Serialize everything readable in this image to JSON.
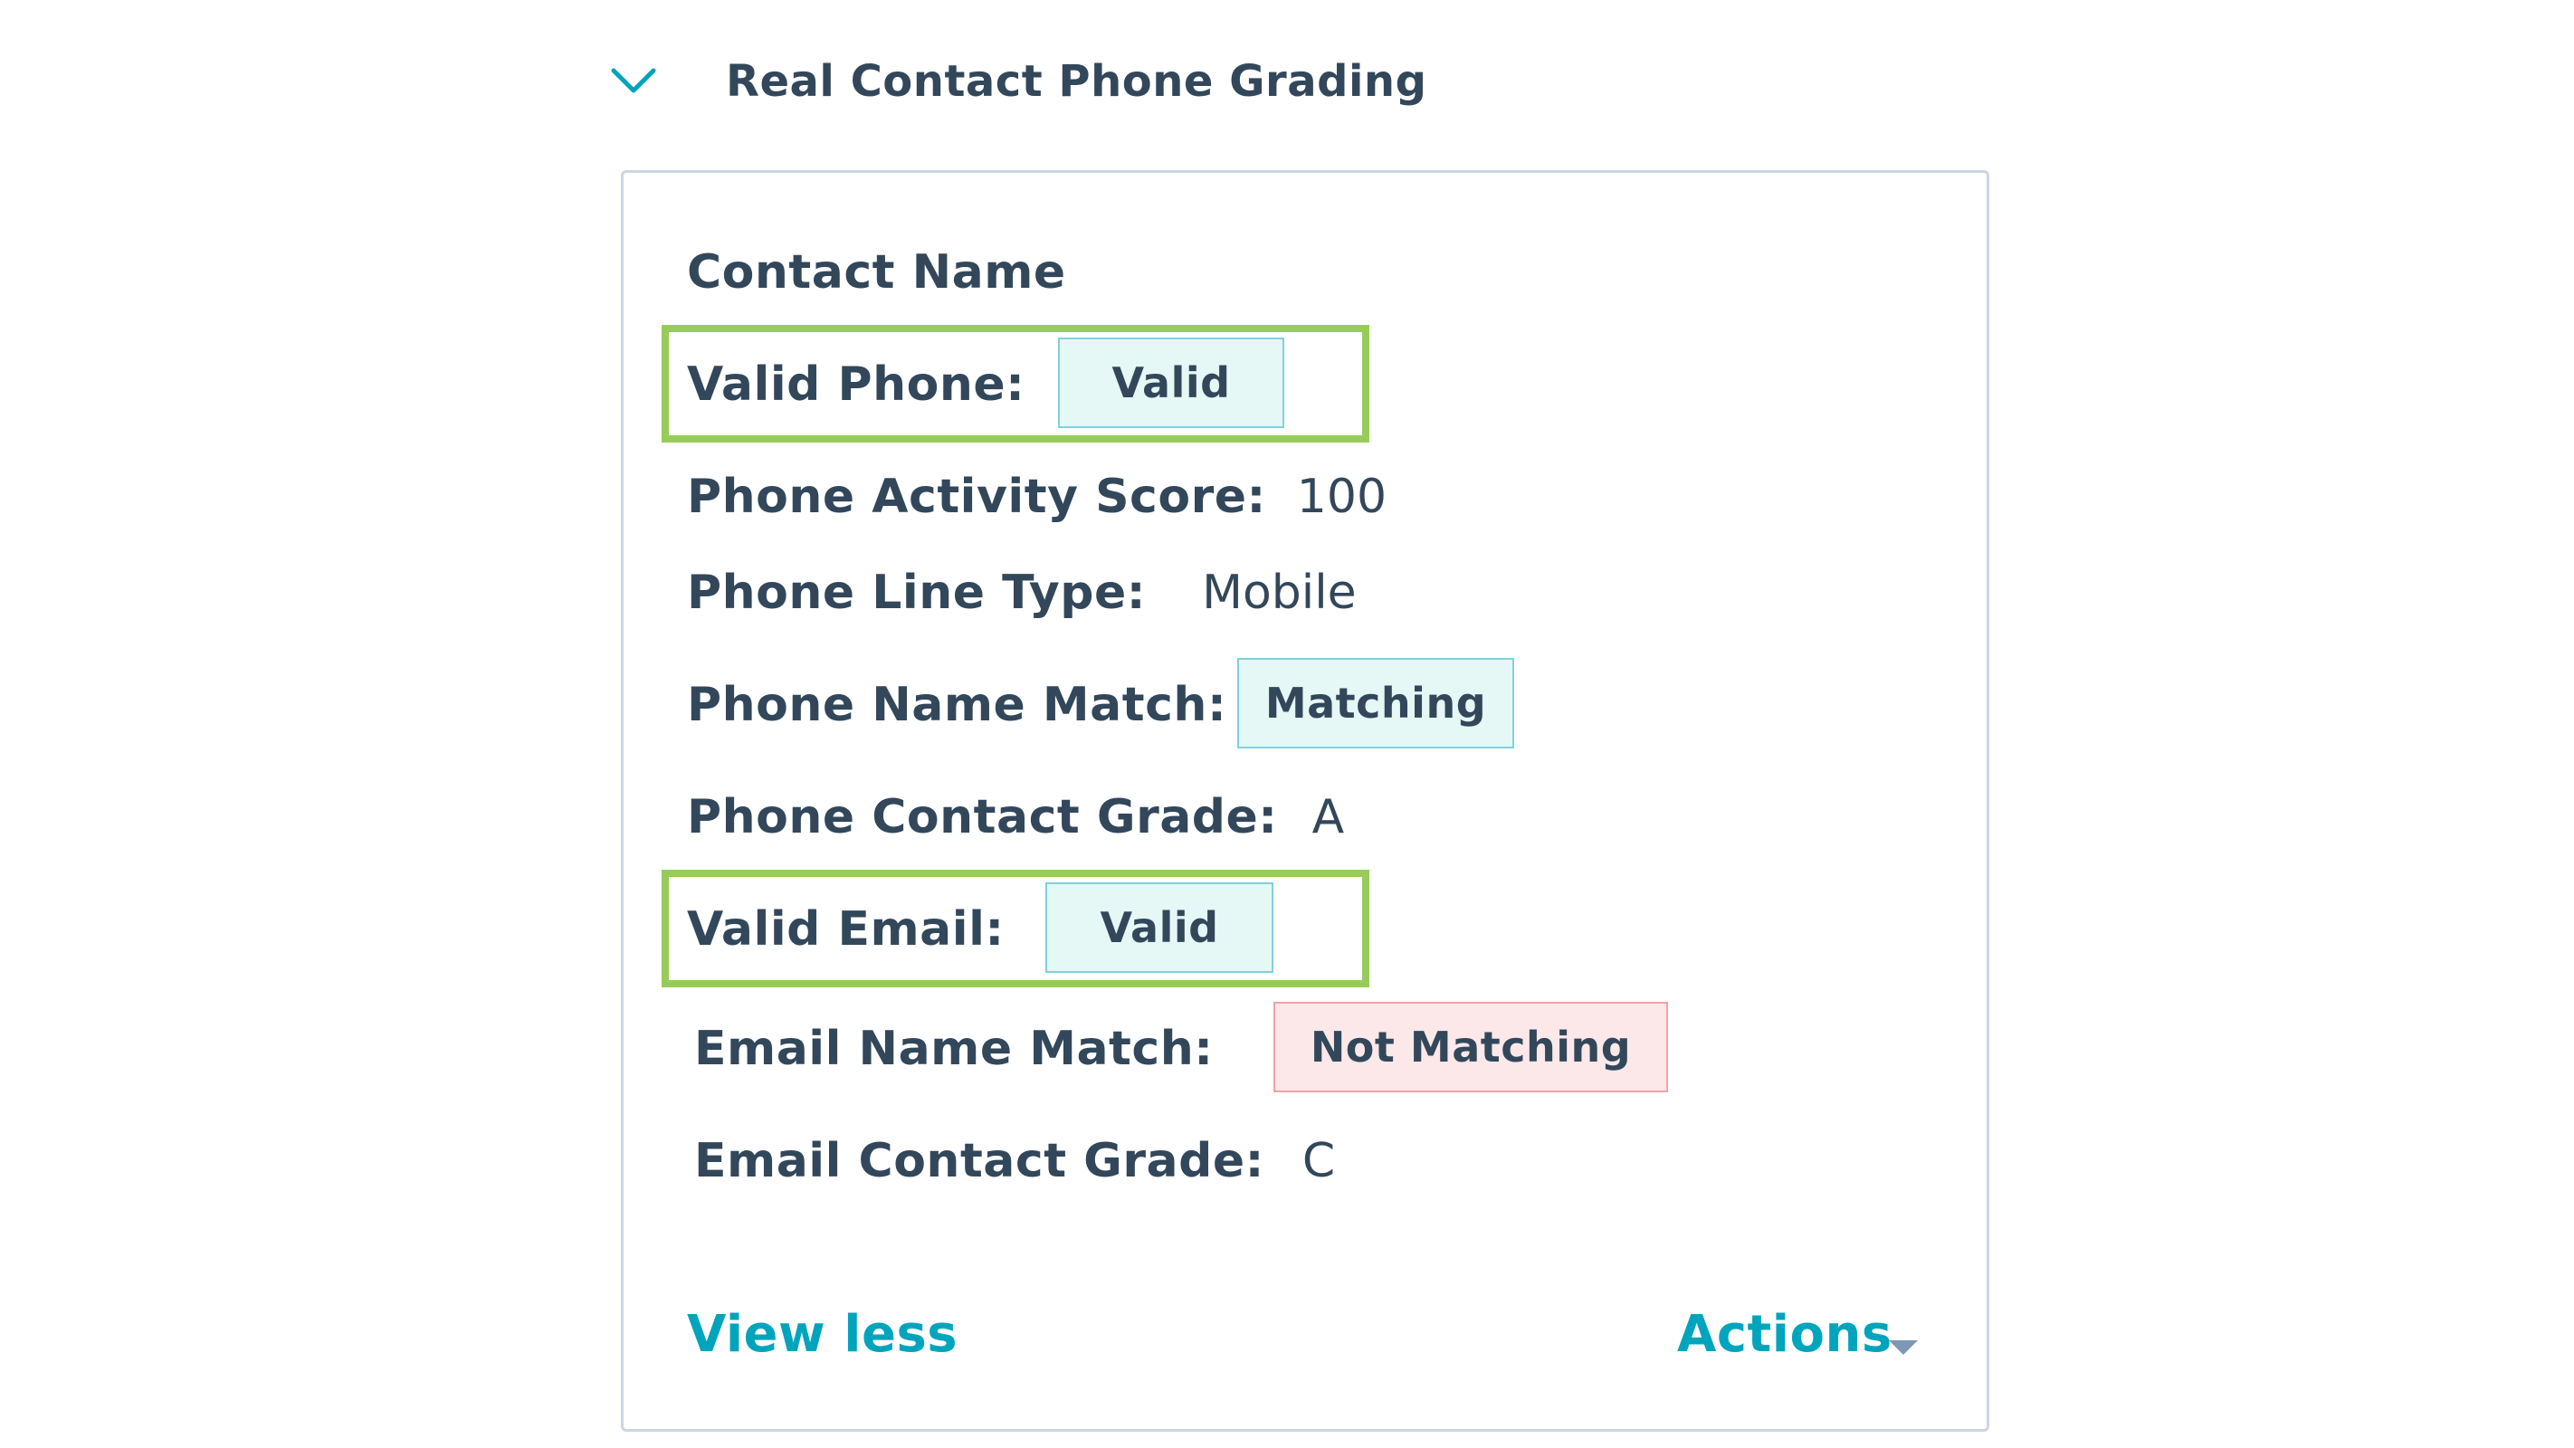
{
  "section": {
    "title": "Real Contact Phone Grading",
    "toggle_icon": "chevron-down-icon",
    "accent_color": "#00a4bd"
  },
  "card": {
    "contact_name": "Contact Name",
    "fields": {
      "valid_phone": {
        "label": "Valid Phone:",
        "value": "Valid",
        "status": "success"
      },
      "phone_activity_score": {
        "label": "Phone Activity Score:",
        "value": "100"
      },
      "phone_line_type": {
        "label": "Phone Line Type:",
        "value": "Mobile"
      },
      "phone_name_match": {
        "label": "Phone Name Match:",
        "value": "Matching",
        "status": "success"
      },
      "phone_contact_grade": {
        "label": "Phone Contact Grade:",
        "value": "A"
      },
      "valid_email": {
        "label": "Valid Email:",
        "value": "Valid",
        "status": "success"
      },
      "email_name_match": {
        "label": "Email Name Match:",
        "value": "Not Matching",
        "status": "danger"
      },
      "email_contact_grade": {
        "label": "Email Contact Grade:",
        "value": "C"
      }
    },
    "highlight_color": "#97cc5a",
    "footer": {
      "view_less_label": "View less",
      "actions_label": "Actions",
      "actions_icon": "caret-down-icon"
    }
  }
}
